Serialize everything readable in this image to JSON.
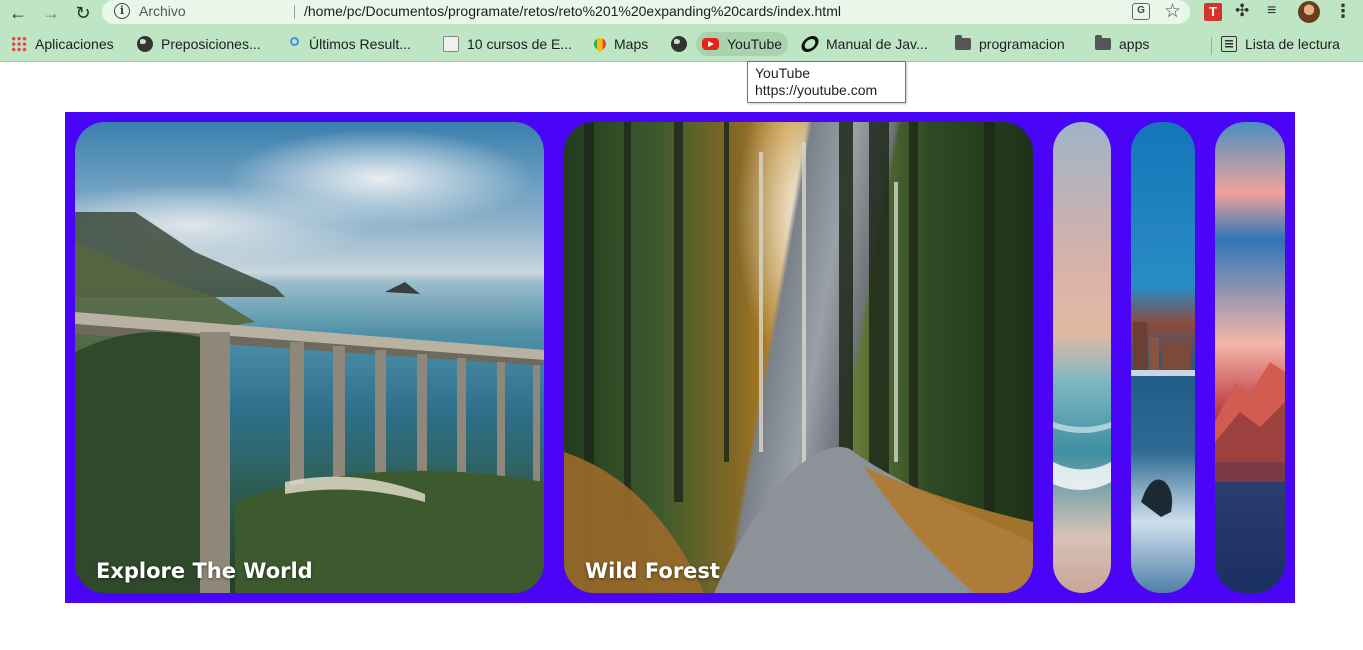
{
  "browser": {
    "url_scheme_label": "Archivo",
    "url": "/home/pc/Documentos/programate/retos/reto%201%20expanding%20cards/index.html",
    "icons": [
      "back-icon",
      "forward-icon",
      "reload-icon",
      "info-icon",
      "translate-icon",
      "star-icon",
      "extension-t-icon",
      "puzzle-icon",
      "media-icon",
      "avatar",
      "menu-icon"
    ]
  },
  "bookmarks": [
    {
      "label": "Aplicaciones",
      "icon": "apps-icon"
    },
    {
      "label": "Preposiciones...",
      "icon": "globe-icon"
    },
    {
      "label": "Últimos Result...",
      "icon": "key-icon"
    },
    {
      "label": "10 cursos de E...",
      "icon": "hand-icon"
    },
    {
      "label": "Maps",
      "icon": "maps-icon"
    },
    {
      "label": "",
      "icon": "globe-icon"
    },
    {
      "label": "YouTube",
      "icon": "youtube-icon"
    },
    {
      "label": "Manual de Jav...",
      "icon": "manual-icon"
    },
    {
      "label": "programacion",
      "icon": "folder-icon"
    },
    {
      "label": "apps",
      "icon": "folder-icon"
    }
  ],
  "reading_list": "Lista de lectura",
  "tooltip": {
    "title": "YouTube",
    "url": "https://youtube.com"
  },
  "page": {
    "background": "#4a05f6",
    "cards": [
      {
        "title": "Explore The World",
        "active": true
      },
      {
        "title": "Wild Forest",
        "active": true
      },
      {
        "title": "",
        "active": false
      },
      {
        "title": "",
        "active": false
      },
      {
        "title": "",
        "active": false
      }
    ]
  }
}
